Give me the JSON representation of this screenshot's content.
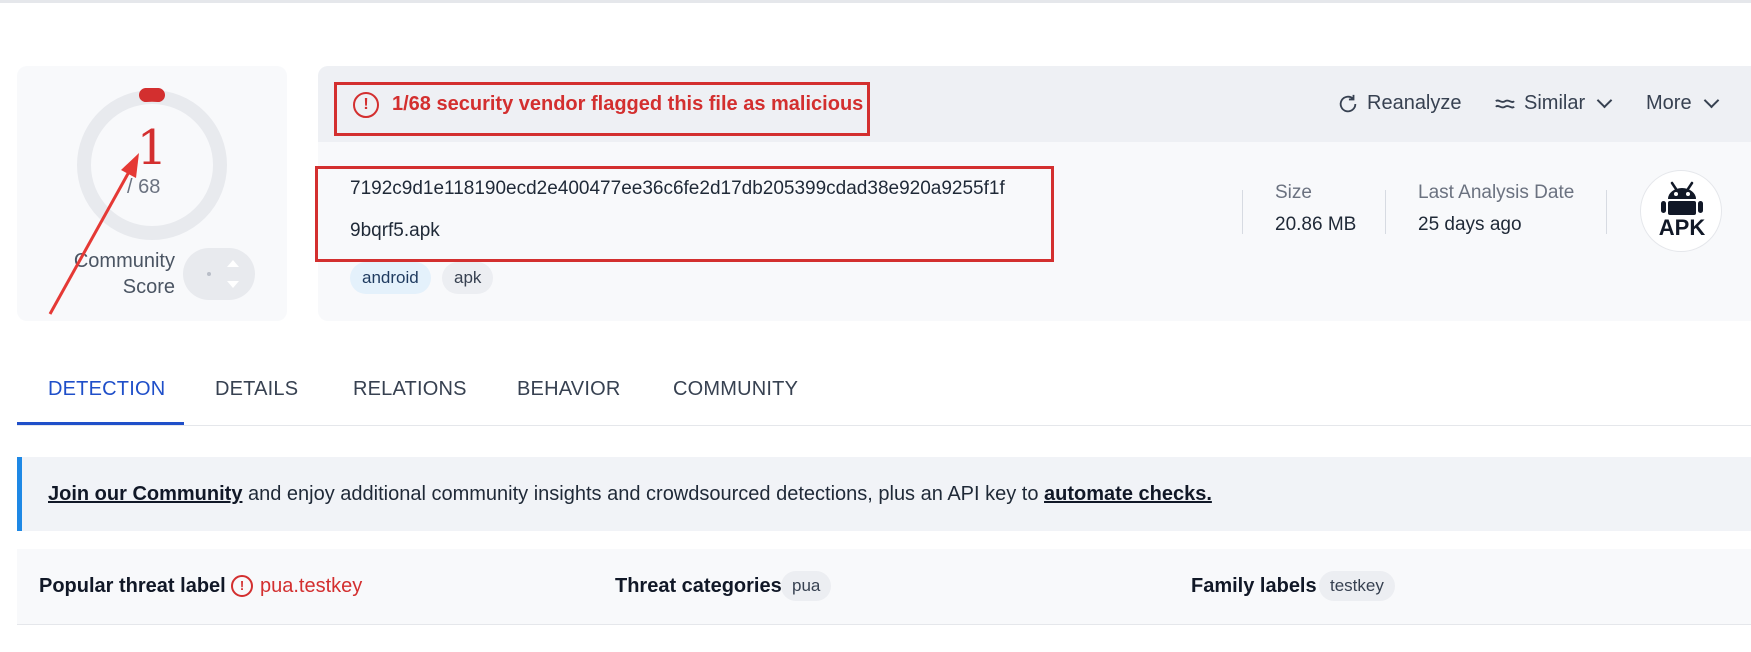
{
  "score": {
    "detections": "1",
    "total": "/ 68",
    "community_label_line1": "Community",
    "community_label_line2": "Score"
  },
  "alert": {
    "text": "1/68 security vendor flagged this file as malicious",
    "icon": "alert-circle-icon"
  },
  "actions": {
    "reanalyze": "Reanalyze",
    "similar": "Similar",
    "more": "More"
  },
  "file": {
    "hash": "7192c9d1e118190ecd2e400477ee36c6fe2d17db205399cdad38e920a9255f1f",
    "name": "9bqrf5.apk",
    "tags": [
      "android",
      "apk"
    ]
  },
  "meta": {
    "size_label": "Size",
    "size_value": "20.86 MB",
    "date_label": "Last Analysis Date",
    "date_value": "25 days ago",
    "type_badge": "APK"
  },
  "tabs": [
    {
      "label": "DETECTION",
      "active": true
    },
    {
      "label": "DETAILS",
      "active": false
    },
    {
      "label": "RELATIONS",
      "active": false
    },
    {
      "label": "BEHAVIOR",
      "active": false
    },
    {
      "label": "COMMUNITY",
      "active": false
    }
  ],
  "banner": {
    "link1": "Join our Community",
    "middle": " and enjoy additional community insights and crowdsourced detections, plus an API key to ",
    "link2": "automate checks."
  },
  "threat": {
    "popular_label": "Popular threat label",
    "popular_value": "pua.testkey",
    "categories_label": "Threat categories",
    "categories_value": "pua",
    "family_label": "Family labels",
    "family_value": "testkey"
  },
  "colors": {
    "danger": "#d32f2f",
    "accent": "#1f4fc9",
    "banner_border": "#1e88e5"
  }
}
